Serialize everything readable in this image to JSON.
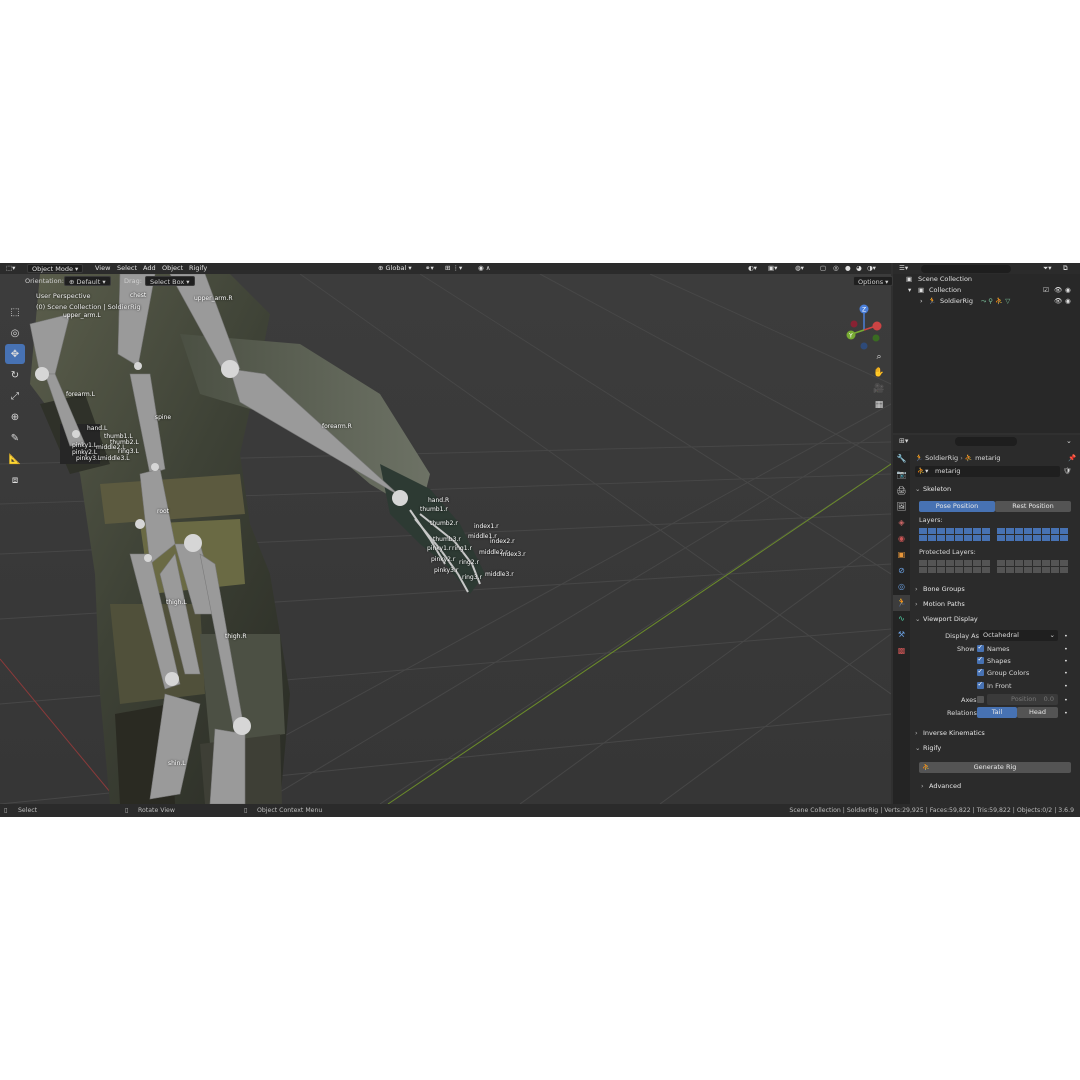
{
  "header": {
    "mode": "Object Mode",
    "menus": [
      "View",
      "Select",
      "Add",
      "Object",
      "Rigify"
    ],
    "transform_orientation": "Global"
  },
  "tool_header": {
    "orientation_label": "Orientation:",
    "orientation_value": "Default",
    "drag_label": "Drag:",
    "drag_value": "Select Box",
    "options": "Options"
  },
  "viewport": {
    "perspective": "User Perspective",
    "collection_info": "(0) Scene Collection | SoldierRig",
    "bone_labels": [
      "chest",
      "upper_arm.R",
      "upper_arm.L",
      "forearm.L",
      "spine",
      "forearm.R",
      "hand.L",
      "thumb1.L",
      "pinky1.L",
      "thumb2.L",
      "pinky2.L",
      "middle2.L",
      "pinky3.L",
      "middle3.L",
      "ring3.L",
      "hand.R",
      "thumb1.r",
      "thumb2.r",
      "index1.r",
      "middle1.r",
      "thumb3.r",
      "index2.r",
      "pinky1.r",
      "ring1.r",
      "middle2.r",
      "index3.r",
      "pinky2.r",
      "ring2.r",
      "pinky3.r",
      "ring3.r",
      "middle3.r",
      "root",
      "thigh.L",
      "thigh.R",
      "shin.L"
    ]
  },
  "status": {
    "select": "Select",
    "rotate": "Rotate View",
    "context": "Object Context Menu",
    "stats": "Scene Collection | SoldierRig | Verts:29,925 | Faces:59,822 | Tris:59,822 | Objects:0/2 | 3.6.9"
  },
  "outliner": {
    "scene_collection": "Scene Collection",
    "collection": "Collection",
    "object": "SoldierRig"
  },
  "properties": {
    "breadcrumb_object": "SoldierRig",
    "breadcrumb_data": "metarig",
    "datablock": "metarig",
    "skeleton": {
      "title": "Skeleton",
      "pose_position": "Pose Position",
      "rest_position": "Rest Position",
      "layers": "Layers:",
      "protected_layers": "Protected Layers:"
    },
    "bone_groups": "Bone Groups",
    "motion_paths": "Motion Paths",
    "viewport_display": {
      "title": "Viewport Display",
      "display_as_label": "Display As",
      "display_as_value": "Octahedral",
      "show_label": "Show",
      "names": "Names",
      "shapes": "Shapes",
      "group_colors": "Group Colors",
      "in_front": "In Front",
      "axes_label": "Axes",
      "position_label": "Position",
      "position_value": "0.0",
      "relations_label": "Relations",
      "tail": "Tail",
      "head": "Head"
    },
    "inverse_kinematics": "Inverse Kinematics",
    "rigify": {
      "title": "Rigify",
      "generate": "Generate Rig",
      "advanced": "Advanced"
    }
  },
  "colors": {
    "accent": "#4772b3",
    "viewport_bg": "#3a3a3a",
    "panel_bg": "#2b2b2b"
  }
}
